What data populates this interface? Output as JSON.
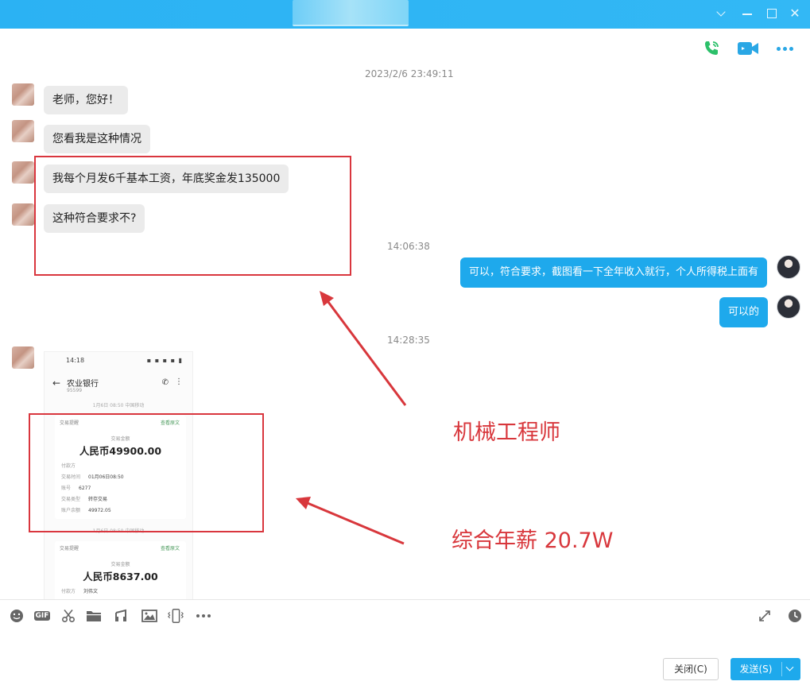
{
  "window": {
    "controls": [
      "dropdown",
      "minimize",
      "maximize",
      "close"
    ]
  },
  "header_actions": [
    {
      "name": "voice-call",
      "icon": "phone-icon",
      "color": "#2cc06a"
    },
    {
      "name": "video-call",
      "icon": "video-camera-icon",
      "color": "#2aa7e5"
    },
    {
      "name": "more",
      "icon": "more-dots-icon",
      "color": "#2aa7e5"
    }
  ],
  "messages": {
    "timestamp_1": "2023/2/6 23:49:11",
    "m1": "老师，您好！",
    "m2": "您看我是这种情况",
    "m3": "我每个月发6千基本工资，年底奖金发135000",
    "m4": "这种符合要求不?",
    "timestamp_2": "14:06:38",
    "r1": "可以，符合要求，截图看一下全年收入就行，个人所得税上面有",
    "r2": "可以的",
    "timestamp_3": "14:28:35"
  },
  "screenshot": {
    "status_time": "14:18",
    "bank_name": "农业银行",
    "bank_number": "95599",
    "date_line_1": "1月6日 08:50 中国移动",
    "card_title": "交易提醒",
    "card_link": "查看原文",
    "amount_label": "交易金额",
    "amount_1": "人民币49900.00",
    "row_payer_label": "付款方",
    "row_time_label": "交易时间",
    "row_time_value": "01月06日08:50",
    "row_account_label": "账号",
    "row_account_value": "6277",
    "row_type_label": "交易类型",
    "row_type_value": "转存交易",
    "row_balance_label": "账户余额",
    "row_balance_value": "49972.05",
    "date_line_2": "1月6日 08:50 中国移动",
    "amount_2": "人民币8637.00",
    "row_payer_value_2": "刘伟文"
  },
  "annotations": {
    "label_1": "机械工程师",
    "label_2": "综合年薪  20.7W",
    "color": "#d8373c"
  },
  "toolbar": {
    "tools": [
      "emoji-icon",
      "gif-icon",
      "scissors-icon",
      "folder-icon",
      "music-icon",
      "image-icon",
      "shake-icon",
      "more-icon"
    ],
    "gif_label": "GIF",
    "right_tools": [
      "expand-icon",
      "history-clock-icon"
    ]
  },
  "buttons": {
    "close_label": "关闭(C)",
    "send_label": "发送(S)"
  },
  "colors": {
    "accent": "#1ea9ec",
    "titlebar": "#2bb2f3"
  }
}
